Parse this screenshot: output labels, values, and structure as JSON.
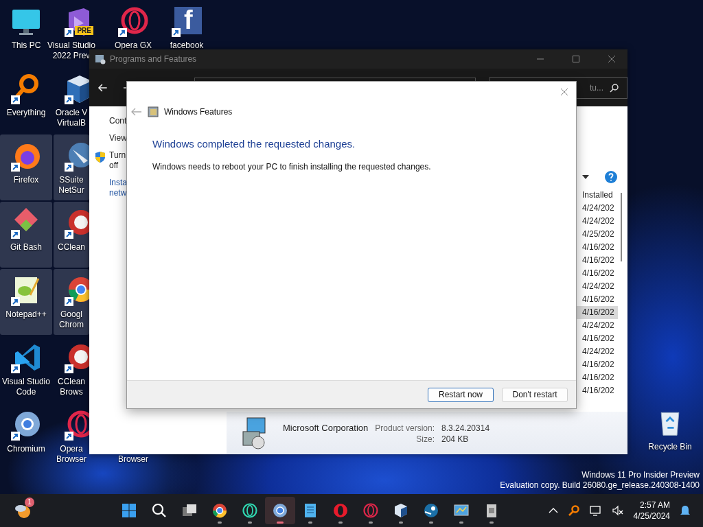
{
  "desktop": {
    "icons": [
      {
        "lines": [
          "This PC"
        ],
        "selected": false
      },
      {
        "lines": [
          "Visual Studio",
          "2022 Prev"
        ],
        "badge": "PRE",
        "selected": false
      },
      {
        "lines": [
          "Opera GX"
        ],
        "selected": false
      },
      {
        "lines": [
          "facebook"
        ],
        "logo_text": "f",
        "selected": false
      },
      {
        "lines": [
          "Everything"
        ],
        "selected": false
      },
      {
        "lines": [
          "Oracle V",
          "VirtualB"
        ],
        "selected": false
      },
      {
        "lines": [
          "Firefox"
        ],
        "selected": true
      },
      {
        "lines": [
          "SSuite",
          "NetSur"
        ],
        "selected": true
      },
      {
        "lines": [
          "Git Bash"
        ],
        "selected": true
      },
      {
        "lines": [
          "CClean"
        ],
        "selected": true
      },
      {
        "lines": [
          "Notepad++"
        ],
        "selected": true
      },
      {
        "lines": [
          "Googl",
          "Chrom"
        ],
        "selected": true
      },
      {
        "lines": [
          "Visual Studio",
          "Code"
        ],
        "selected": false
      },
      {
        "lines": [
          "CClean",
          "Brows"
        ],
        "selected": false
      },
      {
        "lines": [
          "Chromium"
        ],
        "selected": false
      },
      {
        "lines": [
          "Opera",
          "Browser"
        ],
        "selected": false
      },
      {
        "lines": [
          "Browser"
        ],
        "selected": false
      }
    ],
    "recycle_bin": {
      "label": "Recycle Bin"
    }
  },
  "programs_window": {
    "title": "Programs and Features",
    "search": {
      "placeholder": "tu..."
    },
    "left_pane": [
      {
        "lines": [
          "Cont"
        ],
        "shield": false
      },
      {
        "lines": [
          "View"
        ],
        "shield": false
      },
      {
        "lines": [
          "Turn",
          "off"
        ],
        "shield": true
      },
      {
        "lines": [
          "Insta",
          "netw"
        ],
        "shield": false
      }
    ],
    "list": {
      "column": "Installed",
      "rows": [
        {
          "date": "4/24/202",
          "selected": false
        },
        {
          "date": "4/24/202",
          "selected": false
        },
        {
          "date": "4/25/202",
          "selected": false
        },
        {
          "date": "4/16/202",
          "selected": false
        },
        {
          "date": "4/16/202",
          "selected": false
        },
        {
          "date": "4/16/202",
          "selected": false
        },
        {
          "date": "4/24/202",
          "selected": false
        },
        {
          "date": "4/16/202",
          "selected": false
        },
        {
          "date": "4/16/202",
          "selected": true
        },
        {
          "date": "4/24/202",
          "selected": false
        },
        {
          "date": "4/16/202",
          "selected": false
        },
        {
          "date": "4/24/202",
          "selected": false
        },
        {
          "date": "4/16/202",
          "selected": false
        },
        {
          "date": "4/16/202",
          "selected": false
        },
        {
          "date": "4/16/202",
          "selected": false
        }
      ]
    },
    "details": {
      "publisher": "Microsoft Corporation",
      "version_label": "Product version:",
      "version": "8.3.24.20314",
      "size_label": "Size:",
      "size": "204 KB"
    }
  },
  "dialog": {
    "title": "Windows Features",
    "heading": "Windows completed the requested changes.",
    "message": "Windows needs to reboot your PC to finish installing the requested changes.",
    "buttons": [
      {
        "label": "Restart now",
        "default": true
      },
      {
        "label": "Don't restart",
        "default": false
      }
    ]
  },
  "watermark": {
    "lines": [
      "Windows 11 Pro Insider Preview",
      "Evaluation copy. Build 26080.ge_release.240308-1400"
    ]
  },
  "taskbar": {
    "widget_badge": "1",
    "apps": [
      {
        "running": false,
        "selected": false
      },
      {
        "running": false,
        "selected": false
      },
      {
        "running": false,
        "selected": false
      },
      {
        "running": true,
        "selected": false
      },
      {
        "running": true,
        "selected": false
      },
      {
        "running": true,
        "selected": true
      },
      {
        "running": true,
        "selected": false
      },
      {
        "running": true,
        "selected": false
      },
      {
        "running": true,
        "selected": false
      },
      {
        "running": true,
        "selected": false
      },
      {
        "running": true,
        "selected": false
      },
      {
        "running": true,
        "selected": false
      },
      {
        "running": true,
        "selected": false
      }
    ],
    "time": "2:57 AM",
    "date": "4/25/2024"
  }
}
